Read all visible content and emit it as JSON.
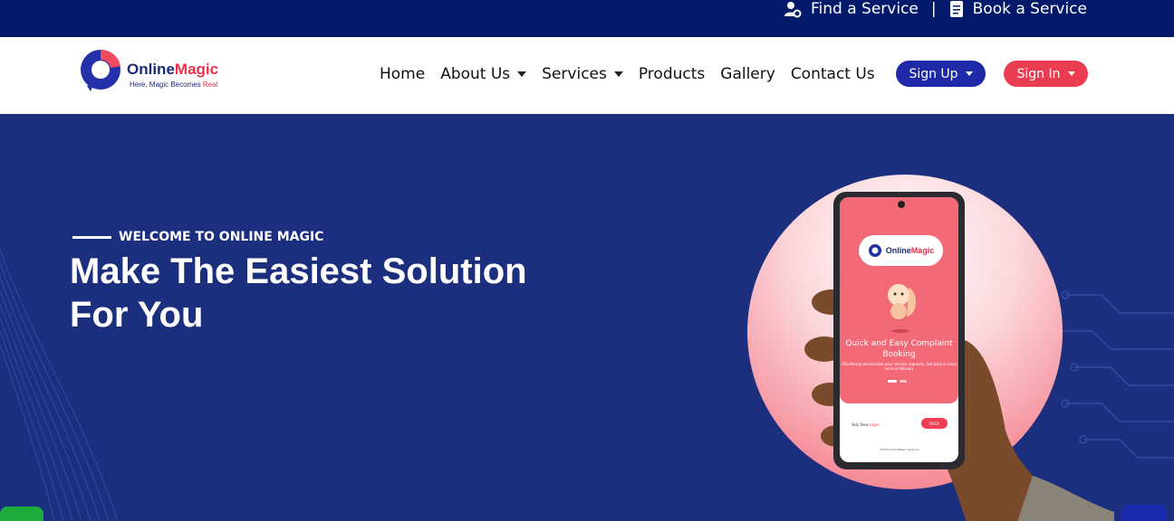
{
  "topbar": {
    "find_service": "Find a Service",
    "separator": "|",
    "book_service": "Book a Service",
    "icons": [
      "user-gear-icon",
      "document-icon"
    ]
  },
  "logo": {
    "brand_first": "Online",
    "brand_second": "Magic",
    "tagline_main": "Here, Magic Becomes ",
    "tagline_accent": "Real"
  },
  "nav": {
    "items": [
      {
        "label": "Home",
        "dropdown": false
      },
      {
        "label": "About Us",
        "dropdown": true
      },
      {
        "label": "Services",
        "dropdown": true
      },
      {
        "label": "Products",
        "dropdown": false
      },
      {
        "label": "Gallery",
        "dropdown": false
      },
      {
        "label": "Contact Us",
        "dropdown": false
      }
    ],
    "signup": "Sign Up",
    "signin": "Sign In"
  },
  "hero": {
    "eyebrow": "WELCOME TO ONLINE MAGIC",
    "headline": "Make The Easiest Solution For You"
  },
  "phone_screen": {
    "badge_first": "Online",
    "badge_second": "Magic",
    "title": "Quick and Easy Complaint Booking",
    "description": "Effortlessly personalize your service requests. Get best-in-class service delivery",
    "skip": "Skip Now",
    "login": "Login",
    "back": "BACK",
    "copyright": "©2022 OnlineMagic Systems"
  },
  "colors": {
    "topbar": "#031a6b",
    "hero": "#1b2f7e",
    "signup": "#1e2aa8",
    "signin": "#ea3d51",
    "accent": "#e8334d"
  }
}
